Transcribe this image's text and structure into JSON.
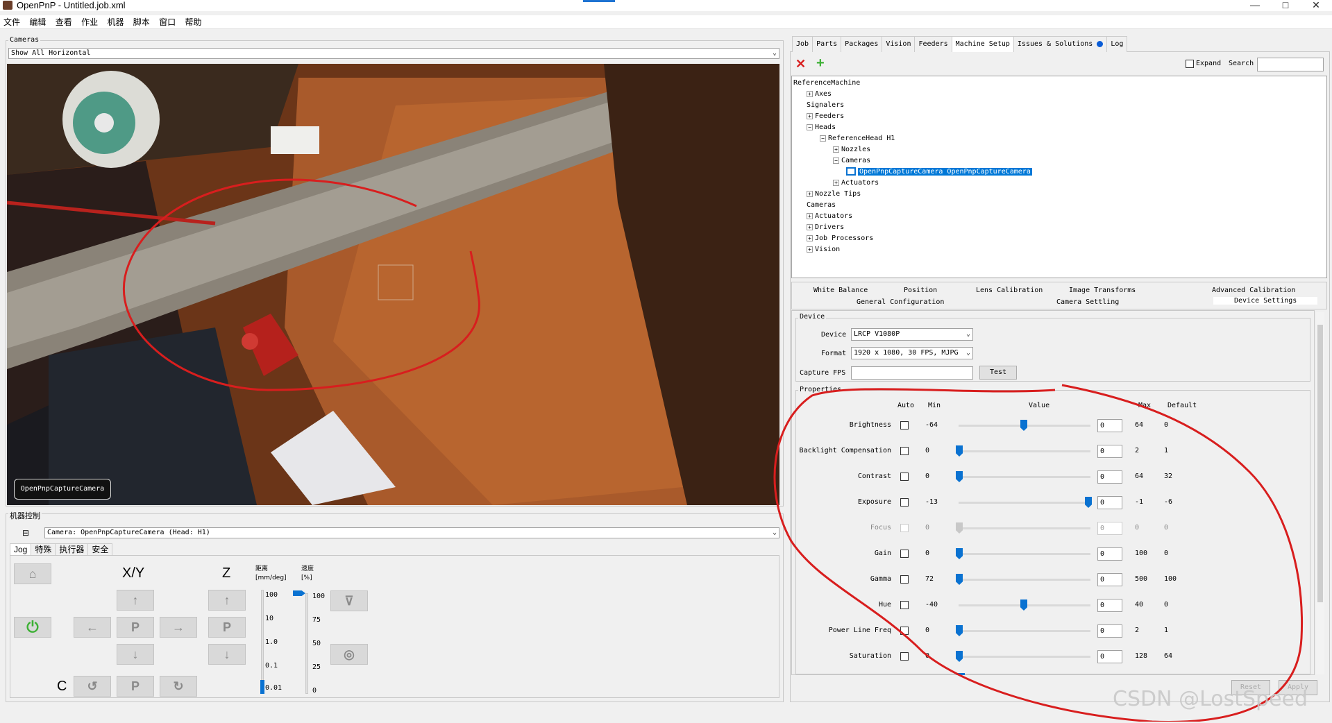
{
  "window": {
    "title": "OpenPnP - Untitled.job.xml",
    "controls": [
      "—",
      "□",
      "✕"
    ]
  },
  "menu": [
    "文件",
    "编辑",
    "查看",
    "作业",
    "机器",
    "脚本",
    "窗口",
    "帮助"
  ],
  "cameras_panel": {
    "group_label": "Cameras",
    "view_mode": "Show All Horizontal",
    "camera_overlay_label": "OpenPnpCaptureCamera"
  },
  "machine_control": {
    "group_label": "机器控制",
    "collapse_icon": "⊟",
    "camera_select": "Camera: OpenPnpCaptureCamera (Head: H1)",
    "tabs": [
      "Jog",
      "特殊",
      "执行器",
      "安全"
    ],
    "active_tab": "Jog",
    "xy_label": "X/Y",
    "z_label": "Z",
    "c_label": "C",
    "park_label": "P",
    "distance_header": "距离\n[mm/deg]",
    "distance_values": [
      "100",
      "10",
      "1.0",
      "0.1",
      "0.01"
    ],
    "speed_header": "速度\n[%]",
    "speed_values": [
      "100",
      "75",
      "50",
      "25",
      "0"
    ],
    "speed_level_percent": 100,
    "distance_selected": "0.01"
  },
  "right_panel": {
    "tabs": [
      "Job",
      "Parts",
      "Packages",
      "Vision",
      "Feeders",
      "Machine Setup",
      "Issues & Solutions",
      "Log"
    ],
    "active_tab": "Machine Setup",
    "expand_label": "Expand",
    "search_label": "Search",
    "tree": [
      {
        "label": "ReferenceMachine",
        "depth": 0,
        "box": ""
      },
      {
        "label": "Axes",
        "depth": 1,
        "box": "+"
      },
      {
        "label": "Signalers",
        "depth": 1,
        "box": ""
      },
      {
        "label": "Feeders",
        "depth": 1,
        "box": "+"
      },
      {
        "label": "Heads",
        "depth": 1,
        "box": "−"
      },
      {
        "label": "ReferenceHead H1",
        "depth": 2,
        "box": "−"
      },
      {
        "label": "Nozzles",
        "depth": 3,
        "box": "+"
      },
      {
        "label": "Cameras",
        "depth": 3,
        "box": "−"
      },
      {
        "label": "OpenPnpCaptureCamera OpenPnpCaptureCamera",
        "depth": 4,
        "box": "",
        "selected": true
      },
      {
        "label": "Actuators",
        "depth": 3,
        "box": "+"
      },
      {
        "label": "Nozzle Tips",
        "depth": 1,
        "box": "+"
      },
      {
        "label": "Cameras",
        "depth": 1,
        "box": ""
      },
      {
        "label": "Actuators",
        "depth": 1,
        "box": "+"
      },
      {
        "label": "Drivers",
        "depth": 1,
        "box": "+"
      },
      {
        "label": "Job Processors",
        "depth": 1,
        "box": "+"
      },
      {
        "label": "Vision",
        "depth": 1,
        "box": "+"
      }
    ],
    "settings_tabs_row1": [
      "White Balance",
      "Position",
      "Lens Calibration",
      "Image Transforms",
      "Advanced Calibration"
    ],
    "settings_tabs_row2": [
      "General Configuration",
      "Camera Settling",
      "Device Settings"
    ],
    "active_settings_tab": "Device Settings",
    "device": {
      "group_label": "Device",
      "device_label": "Device",
      "device_value": "LRCP  V1080P",
      "format_label": "Format",
      "format_value": "1920 x 1080, 30 FPS, MJPG",
      "capture_fps_label": "Capture FPS",
      "capture_fps_value": "",
      "test_button": "Test"
    },
    "properties": {
      "group_label": "Properties",
      "headers": {
        "auto": "Auto",
        "min": "Min",
        "value": "Value",
        "max": "Max",
        "default": "Default"
      },
      "rows": [
        {
          "name": "Brightness",
          "min": "-64",
          "value": "0",
          "max": "64",
          "default": "0",
          "level": 0.5,
          "disabled": false
        },
        {
          "name": "Backlight Compensation",
          "min": "0",
          "value": "0",
          "max": "2",
          "default": "1",
          "level": 0,
          "disabled": false
        },
        {
          "name": "Contrast",
          "min": "0",
          "value": "0",
          "max": "64",
          "default": "32",
          "level": 0,
          "disabled": false
        },
        {
          "name": "Exposure",
          "min": "-13",
          "value": "0",
          "max": "-1",
          "default": "-6",
          "level": 1,
          "disabled": false
        },
        {
          "name": "Focus",
          "min": "0",
          "value": "0",
          "max": "0",
          "default": "0",
          "level": 0,
          "disabled": true
        },
        {
          "name": "Gain",
          "min": "0",
          "value": "0",
          "max": "100",
          "default": "0",
          "level": 0,
          "disabled": false
        },
        {
          "name": "Gamma",
          "min": "72",
          "value": "0",
          "max": "500",
          "default": "100",
          "level": 0,
          "disabled": false
        },
        {
          "name": "Hue",
          "min": "-40",
          "value": "0",
          "max": "40",
          "default": "0",
          "level": 0.5,
          "disabled": false
        },
        {
          "name": "Power Line Freq",
          "min": "0",
          "value": "0",
          "max": "2",
          "default": "1",
          "level": 0,
          "disabled": false
        },
        {
          "name": "Saturation",
          "min": "0",
          "value": "0",
          "max": "128",
          "default": "64",
          "level": 0,
          "disabled": false
        }
      ]
    },
    "reset_button": "Reset",
    "apply_button": "Apply"
  },
  "watermark": "CSDN @LostSpeed",
  "colors": {
    "accent": "#0a72d1",
    "annotation": "#d81e1e",
    "selection": "#0078d7",
    "power": "#3cb034"
  }
}
